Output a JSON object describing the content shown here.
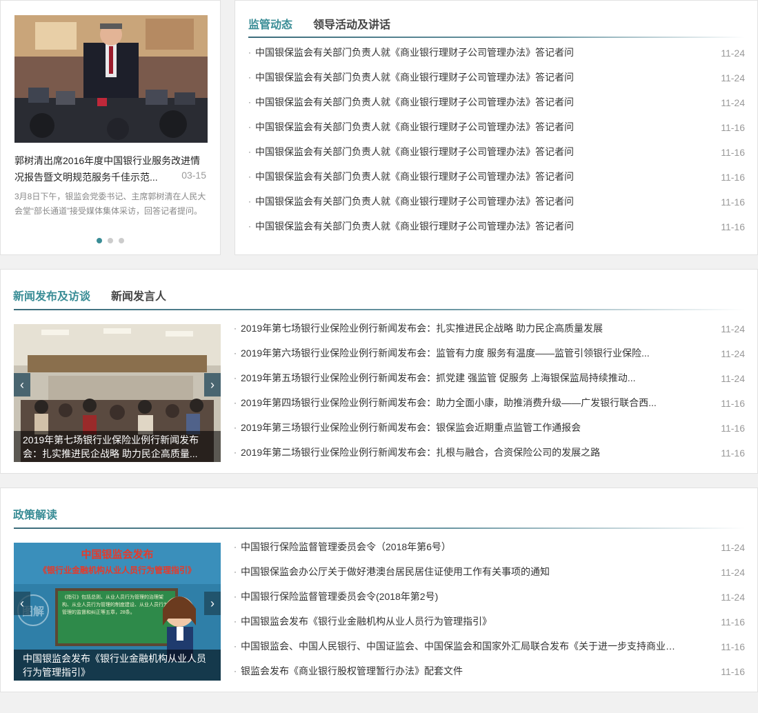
{
  "featured": {
    "title": "郭树清出席2016年度中国银行业服务改进情况报告暨文明规范服务千佳示范...",
    "date": "03-15",
    "summary": "3月8日下午，银监会党委书记、主席郭树清在人民大会堂“部长通道”接受媒体集体采访，回答记者提问。"
  },
  "regulatory": {
    "tabs": [
      "监管动态",
      "领导活动及讲话"
    ],
    "items": [
      {
        "text": "中国银保监会有关部门负责人就《商业银行理财子公司管理办法》答记者问",
        "date": "11-24"
      },
      {
        "text": "中国银保监会有关部门负责人就《商业银行理财子公司管理办法》答记者问",
        "date": "11-24"
      },
      {
        "text": "中国银保监会有关部门负责人就《商业银行理财子公司管理办法》答记者问",
        "date": "11-24"
      },
      {
        "text": "中国银保监会有关部门负责人就《商业银行理财子公司管理办法》答记者问",
        "date": "11-16"
      },
      {
        "text": "中国银保监会有关部门负责人就《商业银行理财子公司管理办法》答记者问",
        "date": "11-16"
      },
      {
        "text": "中国银保监会有关部门负责人就《商业银行理财子公司管理办法》答记者问",
        "date": "11-16"
      },
      {
        "text": "中国银保监会有关部门负责人就《商业银行理财子公司管理办法》答记者问",
        "date": "11-16"
      },
      {
        "text": "中国银保监会有关部门负责人就《商业银行理财子公司管理办法》答记者问",
        "date": "11-16"
      }
    ]
  },
  "press": {
    "tabs": [
      "新闻发布及访谈",
      "新闻发言人"
    ],
    "caption": "2019年第七场银行业保险业例行新闻发布会：扎实推进民企战略 助力民企高质量...",
    "items": [
      {
        "text": "2019年第七场银行业保险业例行新闻发布会：扎实推进民企战略 助力民企高质量发展",
        "date": "11-24"
      },
      {
        "text": "2019年第六场银行业保险业例行新闻发布会：监管有力度 服务有温度——监管引领银行业保险...",
        "date": "11-24"
      },
      {
        "text": "2019年第五场银行业保险业例行新闻发布会：抓党建 强监管 促服务 上海银保监局持续推动...",
        "date": "11-24"
      },
      {
        "text": "2019年第四场银行业保险业例行新闻发布会：助力全面小康，助推消费升级——广发银行联合西...",
        "date": "11-16"
      },
      {
        "text": "2019年第三场银行业保险业例行新闻发布会：银保监会近期重点监管工作通报会",
        "date": "11-16"
      },
      {
        "text": "2019年第二场银行业保险业例行新闻发布会：扎根与融合，合资保险公司的发展之路",
        "date": "11-16"
      }
    ]
  },
  "policy": {
    "tabs": [
      "政策解读"
    ],
    "caption": "中国银监会发布《银行业金融机构从业人员行为管理指引》",
    "poster": {
      "headline": "中国银监会发布",
      "subline": "《银行业金融机构从业人员行为管理指引》",
      "board_text": "《指引》包括总则、从业人员行为管理的治理架构、从业人员行为管理的制度建设、从业人员行为管理的监督和纠正等五章，28条。",
      "stamp": "图解"
    },
    "items": [
      {
        "text": "中国银行保险监督管理委员会令（2018年第6号）",
        "date": "11-24"
      },
      {
        "text": "中国银保监会办公厅关于做好港澳台居民居住证使用工作有关事项的通知",
        "date": "11-24"
      },
      {
        "text": "中国银行保险监督管理委员会令(2018年第2号)",
        "date": "11-24"
      },
      {
        "text": "中国银监会发布《银行业金融机构从业人员行为管理指引》",
        "date": "11-16"
      },
      {
        "text": "中国银监会、中国人民银行、中国证监会、中国保监会和国家外汇局联合发布《关于进一步支持商业银...",
        "date": "11-16"
      },
      {
        "text": "银监会发布《商业银行股权管理暂行办法》配套文件",
        "date": "11-16"
      }
    ]
  }
}
